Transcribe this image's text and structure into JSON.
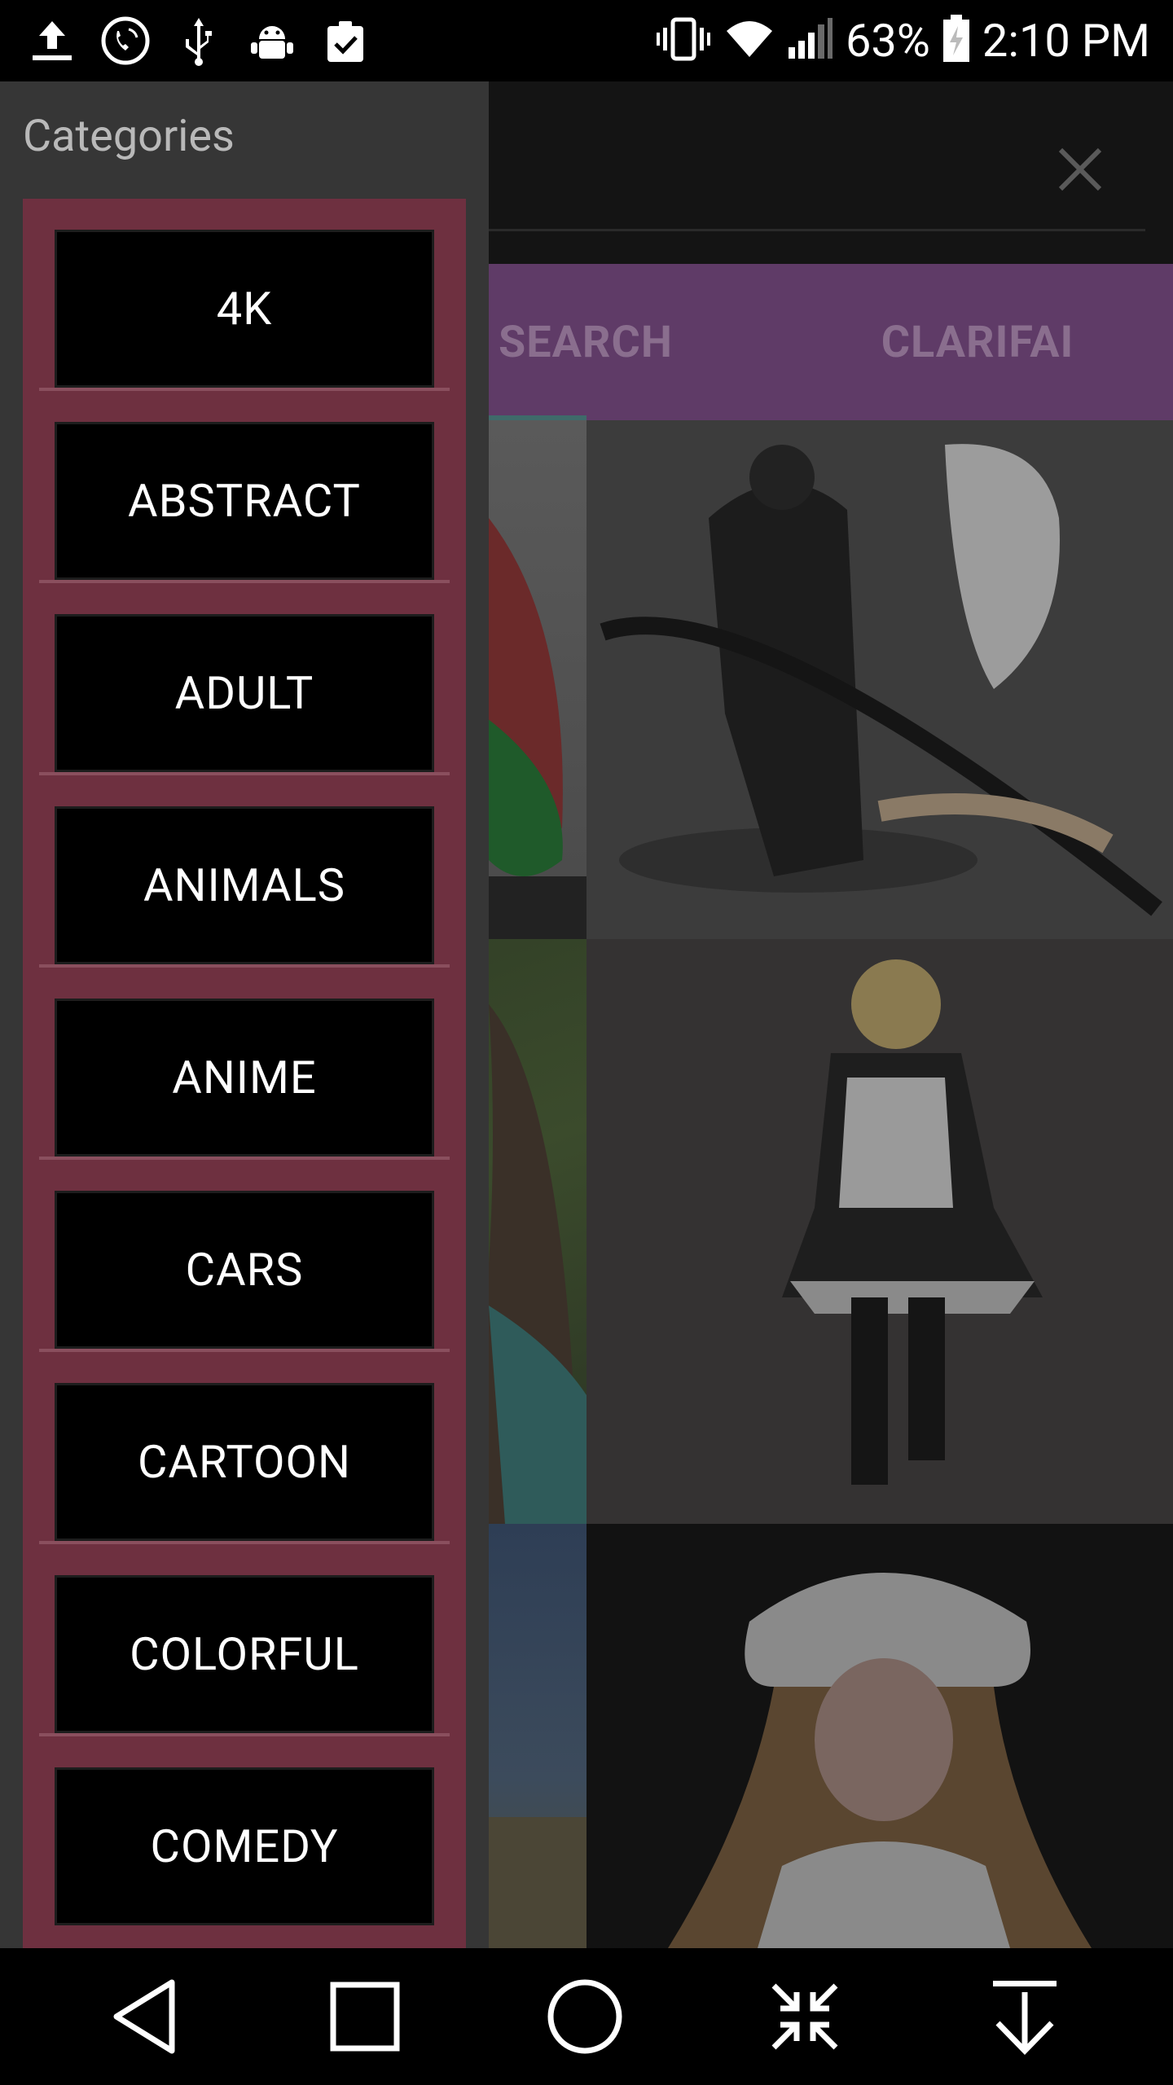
{
  "status_bar": {
    "battery": "63%",
    "time": "2:10 PM",
    "left_icons": [
      "upload-icon",
      "phone-call-icon",
      "usb-icon",
      "android-debug-icon",
      "clipboard-check-icon"
    ],
    "right_icons": [
      "vibrate-icon",
      "wifi-icon",
      "signal-icon",
      "battery-charging-icon"
    ]
  },
  "drawer": {
    "title": "Categories",
    "categories": [
      "4K",
      "ABSTRACT",
      "ADULT",
      "ANIMALS",
      "ANIME",
      "CARS",
      "CARTOON",
      "COLORFUL",
      "COMEDY"
    ],
    "panel_color": "#6e3040"
  },
  "main": {
    "tabs": [
      "SEARCH",
      "CLARIFAI"
    ],
    "accent": "#5f3b67",
    "close_icon": "close-icon",
    "photos": [
      {
        "id": "photo-1",
        "icon": "image-icon"
      },
      {
        "id": "photo-2",
        "icon": "image-icon"
      },
      {
        "id": "photo-3",
        "icon": "image-icon"
      },
      {
        "id": "photo-4",
        "icon": "image-icon"
      },
      {
        "id": "photo-5",
        "icon": "image-icon"
      },
      {
        "id": "photo-6",
        "icon": "image-icon"
      }
    ]
  },
  "nav_bar": {
    "buttons": [
      "back-icon",
      "recents-icon",
      "home-icon",
      "collapse-icon",
      "download-icon"
    ]
  }
}
